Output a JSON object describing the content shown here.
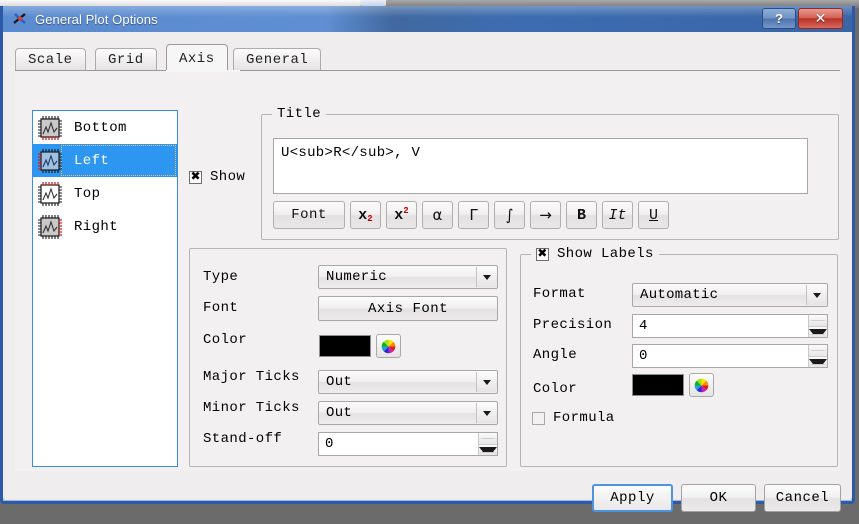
{
  "window": {
    "title": "General Plot Options",
    "app_icon": "plot-app-icon",
    "help_button": "?",
    "close_button": "✕",
    "titlebar_color": "#4274b4",
    "border_color": "#2c5aa8"
  },
  "tabs": [
    {
      "label": "Scale",
      "active": false
    },
    {
      "label": "Grid",
      "active": false
    },
    {
      "label": "Axis",
      "active": true
    },
    {
      "label": "General",
      "active": false
    }
  ],
  "axis_list": [
    {
      "label": "Bottom",
      "icon": "axis-bottom-icon",
      "selected": false,
      "highlight_edge": "bottom"
    },
    {
      "label": "Left",
      "icon": "axis-left-icon",
      "selected": true,
      "highlight_edge": "left"
    },
    {
      "label": "Top",
      "icon": "axis-top-icon",
      "selected": false,
      "highlight_edge": "top"
    },
    {
      "label": "Right",
      "icon": "axis-right-icon",
      "selected": false,
      "highlight_edge": "right"
    }
  ],
  "show_title": {
    "label": "Show",
    "checked": true,
    "mark": "✖"
  },
  "title_group": {
    "legend": "Title",
    "text_value": "U<sub>R</sub>, V",
    "placeholder": "",
    "toolbar": [
      {
        "name": "font-button",
        "label": "Font",
        "kind": "text"
      },
      {
        "name": "subscript-button",
        "base": "x",
        "script": "2",
        "kind": "sub"
      },
      {
        "name": "superscript-button",
        "base": "x",
        "script": "2",
        "kind": "sup"
      },
      {
        "name": "greek-alpha-button",
        "label": "α",
        "kind": "greek"
      },
      {
        "name": "greek-gamma-button",
        "label": "Γ",
        "kind": "greek"
      },
      {
        "name": "integral-button",
        "label": "∫",
        "kind": "greek"
      },
      {
        "name": "arrow-button",
        "label": "→",
        "kind": "greek"
      },
      {
        "name": "bold-button",
        "label": "B",
        "kind": "bold"
      },
      {
        "name": "italic-button",
        "label": "It",
        "kind": "italic"
      },
      {
        "name": "underline-button",
        "label": "U",
        "kind": "under"
      }
    ]
  },
  "axis_settings": {
    "type": {
      "label": "Type",
      "value": "Numeric"
    },
    "font": {
      "label": "Font",
      "button_label": "Axis Font"
    },
    "color": {
      "label": "Color",
      "value": "#000000",
      "picker_icon": "color-wheel-icon"
    },
    "major_ticks": {
      "label": "Major Ticks",
      "value": "Out"
    },
    "minor_ticks": {
      "label": "Minor Ticks",
      "value": "Out"
    },
    "standoff": {
      "label": "Stand-off",
      "value": "0"
    }
  },
  "labels_group": {
    "legend": "Show Labels",
    "checked": true,
    "mark": "✖",
    "format": {
      "label": "Format",
      "value": "Automatic"
    },
    "precision": {
      "label": "Precision",
      "value": "4"
    },
    "angle": {
      "label": "Angle",
      "value": "0"
    },
    "color": {
      "label": "Color",
      "value": "#000000",
      "picker_icon": "color-wheel-icon"
    },
    "formula": {
      "label": "Formula",
      "checked": false
    }
  },
  "buttons": {
    "apply": "Apply",
    "ok": "OK",
    "cancel": "Cancel"
  }
}
